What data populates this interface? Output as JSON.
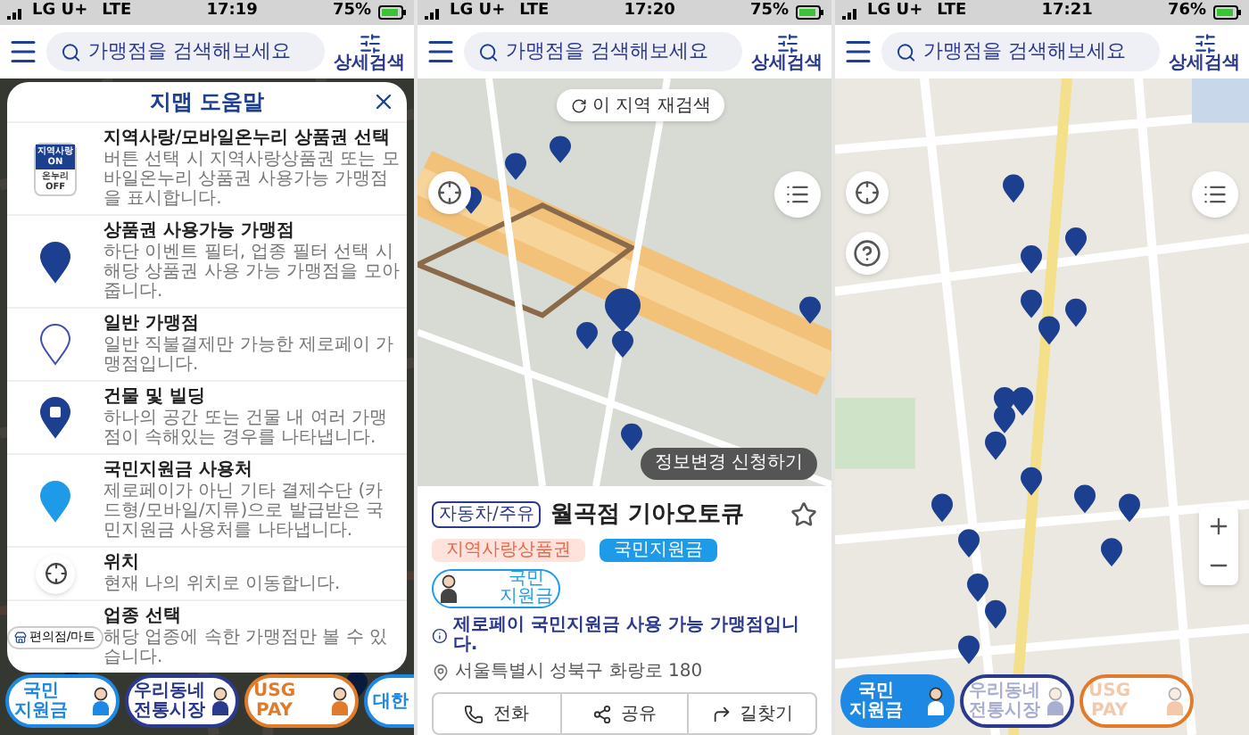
{
  "screens": [
    {
      "status": {
        "carrier": "LG U+",
        "network": "LTE",
        "time": "17:19",
        "battery": "75%"
      },
      "search": {
        "placeholder": "가맹점을 검색해보세요",
        "filter_label": "상세검색"
      },
      "map": {
        "kind": "dark"
      },
      "help_dialog": {
        "title": "지맵 도움말",
        "items": [
          {
            "kind": "toggle",
            "toggle_on": [
              "지역사랑",
              "ON"
            ],
            "toggle_off": [
              "온누리",
              "OFF"
            ],
            "title": "지역사랑/모바일온누리 상품권 선택",
            "text": "버튼 선택 시 지역사랑상품권 또는 모바일온누리 상품권 사용가능 가맹점을 표시합니다."
          },
          {
            "kind": "pin-filled",
            "title": "상품권 사용가능 가맹점",
            "text": "하단 이벤트 필터, 업종 필터 선택 시 해당 상품권 사용 가능 가맹점을 모아줍니다."
          },
          {
            "kind": "pin-outline",
            "title": "일반 가맹점",
            "text": "일반 직불결제만 가능한 제로페이 가맹점입니다."
          },
          {
            "kind": "pin-building",
            "title": "건물 및 빌딩",
            "text": "하나의 공간 또는 건물 내 여러 가맹점이 속해있는 경우를 나타냅니다."
          },
          {
            "kind": "pin-light",
            "title": "국민지원금 사용처",
            "text": "제로페이가 아닌 기타 결제수단 (카드형/모바일/지류)으로 발급받은 국민지원금 사용처를 나타냅니다."
          },
          {
            "kind": "location",
            "title": "위치",
            "text": "현재 나의 위치로 이동합니다."
          },
          {
            "kind": "category",
            "chip": "편의점/마트",
            "title": "업종 선택",
            "text": "해당 업종에 속한 가맹점만 볼 수 있습니다."
          }
        ]
      },
      "chips": [
        {
          "lines": [
            "국민",
            "지원금"
          ],
          "color": "#1e88e5",
          "selected": false,
          "dimmed": false
        },
        {
          "lines": [
            "우리동네",
            "전통시장"
          ],
          "color": "#2b3a8c",
          "selected": false,
          "dimmed": false
        },
        {
          "lines": [
            "USG",
            "PAY"
          ],
          "color": "#e07b2c",
          "selected": false,
          "dimmed": false
        },
        {
          "lines": [
            "대한"
          ],
          "color": "#1e88e5",
          "selected": false,
          "dimmed": false
        }
      ]
    },
    {
      "status": {
        "carrier": "LG U+",
        "network": "LTE",
        "time": "17:20",
        "battery": "75%"
      },
      "search": {
        "placeholder": "가맹점을 검색해보세요",
        "filter_label": "상세검색"
      },
      "map": {
        "kind": "satellite"
      },
      "controls": [
        {
          "kind": "locate"
        },
        {
          "kind": "list"
        }
      ],
      "rescan_button": "이 지역 재검색",
      "edit_request_button": "정보변경 신청하기",
      "place": {
        "category": "자동차/주유",
        "name": "월곡점 기아오토큐",
        "favorite": false,
        "tags": [
          {
            "label": "지역사랑상품권",
            "kind": "soft"
          },
          {
            "label": "국민지원금",
            "kind": "solid"
          }
        ],
        "badge": [
          "국민",
          "지원금"
        ],
        "notice": "제로페이 국민지원금 사용 가능 가맹점입니다.",
        "address": "서울특별시 성북구 화랑로 180",
        "actions": [
          {
            "kind": "call",
            "label": "전화"
          },
          {
            "kind": "share",
            "label": "공유"
          },
          {
            "kind": "route",
            "label": "길찾기"
          }
        ]
      }
    },
    {
      "status": {
        "carrier": "LG U+",
        "network": "LTE",
        "time": "17:21",
        "battery": "76%"
      },
      "search": {
        "placeholder": "가맹점을 검색해보세요",
        "filter_label": "상세검색"
      },
      "map": {
        "kind": "street"
      },
      "controls": [
        {
          "kind": "locate"
        },
        {
          "kind": "help"
        },
        {
          "kind": "list"
        },
        {
          "kind": "zoom"
        }
      ],
      "chips": [
        {
          "lines": [
            "국민",
            "지원금"
          ],
          "color": "#1e88e5",
          "selected": true,
          "dimmed": false
        },
        {
          "lines": [
            "우리동네",
            "전통시장"
          ],
          "color": "#2b3a8c",
          "selected": false,
          "dimmed": true
        },
        {
          "lines": [
            "USG",
            "PAY"
          ],
          "color": "#e07b2c",
          "selected": false,
          "dimmed": true
        }
      ]
    }
  ]
}
